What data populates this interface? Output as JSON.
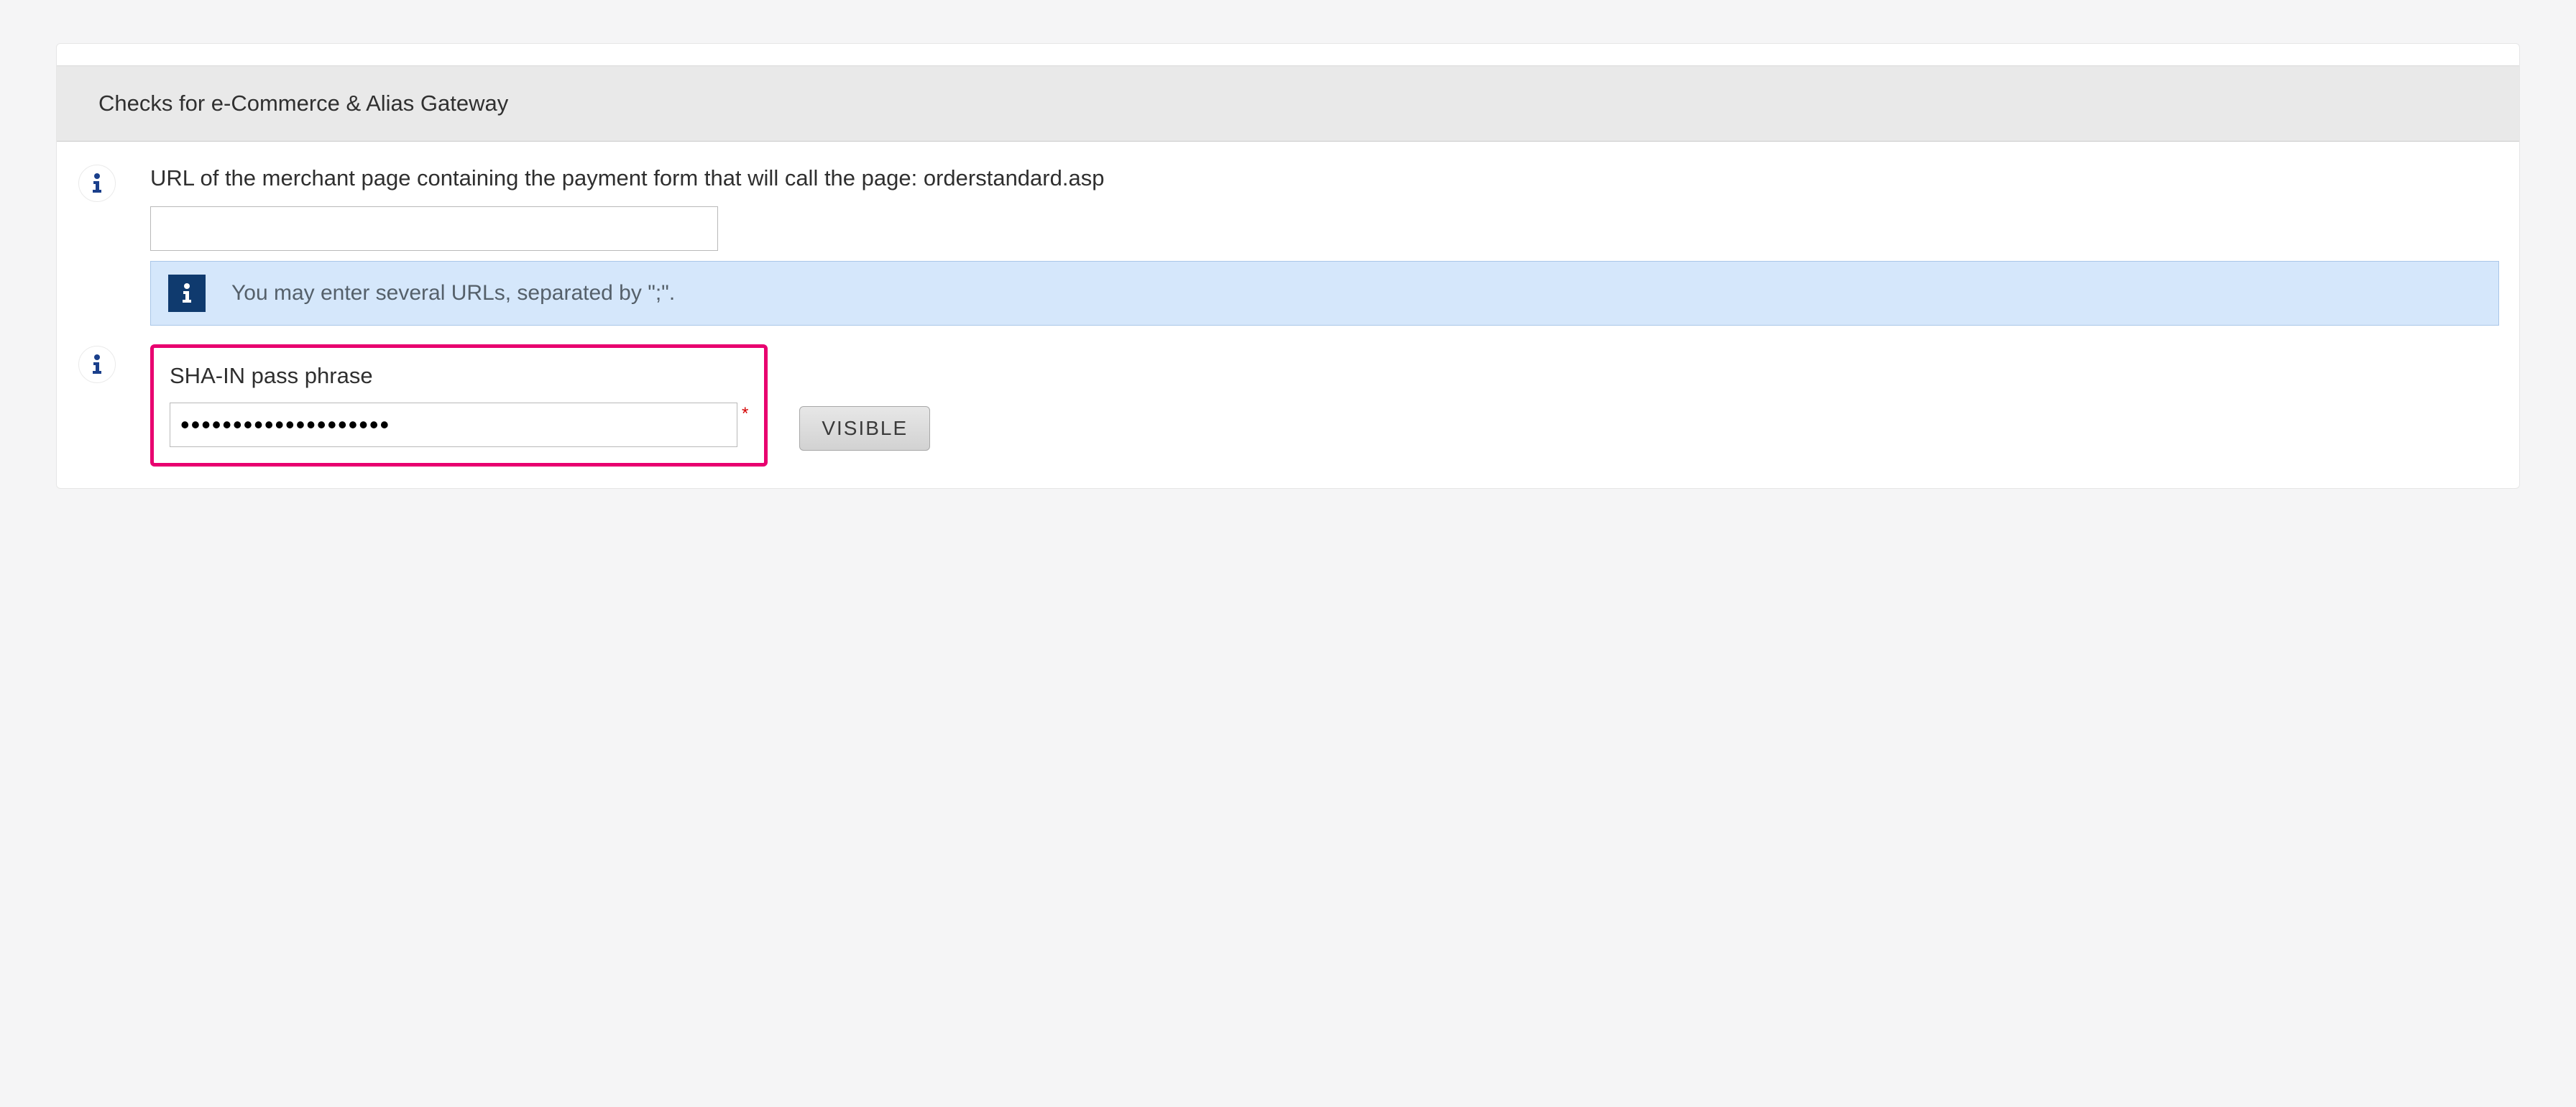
{
  "section": {
    "title": "Checks for e-Commerce & Alias Gateway"
  },
  "url_field": {
    "label": "URL of the merchant page containing the payment form that will call the page: orderstandard.asp",
    "value": "",
    "note": "You may enter several URLs, separated by \";\"."
  },
  "sha_field": {
    "label": "SHA-IN pass phrase",
    "value": "••••••••••••••••••••",
    "required_marker": "*",
    "visible_button_label": "VISIBLE"
  }
}
